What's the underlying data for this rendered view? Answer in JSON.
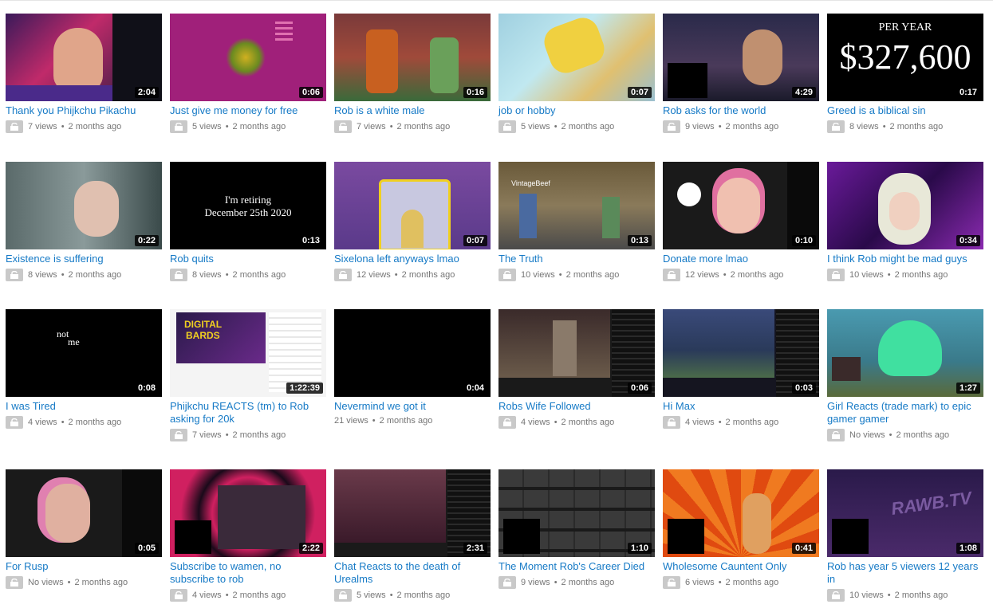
{
  "colors": {
    "title": "#167ac6",
    "meta": "#767676",
    "duration_bg": "#000000"
  },
  "icons": {
    "privacy": "unlisted-lock-icon"
  },
  "thumb_text": {
    "greed_top": "PER YEAR",
    "greed_amount": "$327,600",
    "retire_line1": "I'm retiring",
    "retire_line2": "December 25th 2020",
    "tired_line1": "not",
    "tired_line2": "me",
    "digital": "DIGITAL",
    "bards": "BARDS",
    "rawb": "RAWB.TV",
    "vintage": "VintageBeef"
  },
  "videos": [
    {
      "title": "Thank you Phijkchu Pikachu",
      "duration": "2:04",
      "views": "7 views",
      "age": "2 months ago"
    },
    {
      "title": "Just give me money for free",
      "duration": "0:06",
      "views": "5 views",
      "age": "2 months ago"
    },
    {
      "title": "Rob is a white male",
      "duration": "0:16",
      "views": "7 views",
      "age": "2 months ago"
    },
    {
      "title": "job or hobby",
      "duration": "0:07",
      "views": "5 views",
      "age": "2 months ago"
    },
    {
      "title": "Rob asks for the world",
      "duration": "4:29",
      "views": "9 views",
      "age": "2 months ago"
    },
    {
      "title": "Greed is a biblical sin",
      "duration": "0:17",
      "views": "8 views",
      "age": "2 months ago"
    },
    {
      "title": "Existence is suffering",
      "duration": "0:22",
      "views": "8 views",
      "age": "2 months ago"
    },
    {
      "title": "Rob quits",
      "duration": "0:13",
      "views": "8 views",
      "age": "2 months ago"
    },
    {
      "title": "Sixelona left anyways lmao",
      "duration": "0:07",
      "views": "12 views",
      "age": "2 months ago"
    },
    {
      "title": "The Truth",
      "duration": "0:13",
      "views": "10 views",
      "age": "2 months ago"
    },
    {
      "title": "Donate more lmao",
      "duration": "0:10",
      "views": "12 views",
      "age": "2 months ago"
    },
    {
      "title": "I think Rob might be mad guys",
      "duration": "0:34",
      "views": "10 views",
      "age": "2 months ago"
    },
    {
      "title": "I was Tired",
      "duration": "0:08",
      "views": "4 views",
      "age": "2 months ago"
    },
    {
      "title": "Phijkchu REACTS (tm) to Rob asking for 20k",
      "duration": "1:22:39",
      "views": "7 views",
      "age": "2 months ago"
    },
    {
      "title": "Nevermind we got it",
      "duration": "0:04",
      "views": "21 views",
      "age": "2 months ago"
    },
    {
      "title": "Robs Wife Followed",
      "duration": "0:06",
      "views": "4 views",
      "age": "2 months ago"
    },
    {
      "title": "Hi Max",
      "duration": "0:03",
      "views": "4 views",
      "age": "2 months ago"
    },
    {
      "title": "Girl Reacts (trade mark) to epic gamer gamer",
      "duration": "1:27",
      "views": "No views",
      "age": "2 months ago"
    },
    {
      "title": "For Rusp",
      "duration": "0:05",
      "views": "No views",
      "age": "2 months ago"
    },
    {
      "title": "Subscribe to wamen, no subscribe to rob",
      "duration": "2:22",
      "views": "4 views",
      "age": "2 months ago"
    },
    {
      "title": "Chat Reacts to the death of Urealms",
      "duration": "2:31",
      "views": "5 views",
      "age": "2 months ago"
    },
    {
      "title": "The Moment Rob's Career Died",
      "duration": "1:10",
      "views": "9 views",
      "age": "2 months ago"
    },
    {
      "title": "Wholesome Cauntent Only",
      "duration": "0:41",
      "views": "6 views",
      "age": "2 months ago"
    },
    {
      "title": "Rob has year 5 viewers 12 years in",
      "duration": "1:08",
      "views": "10 views",
      "age": "2 months ago"
    }
  ]
}
